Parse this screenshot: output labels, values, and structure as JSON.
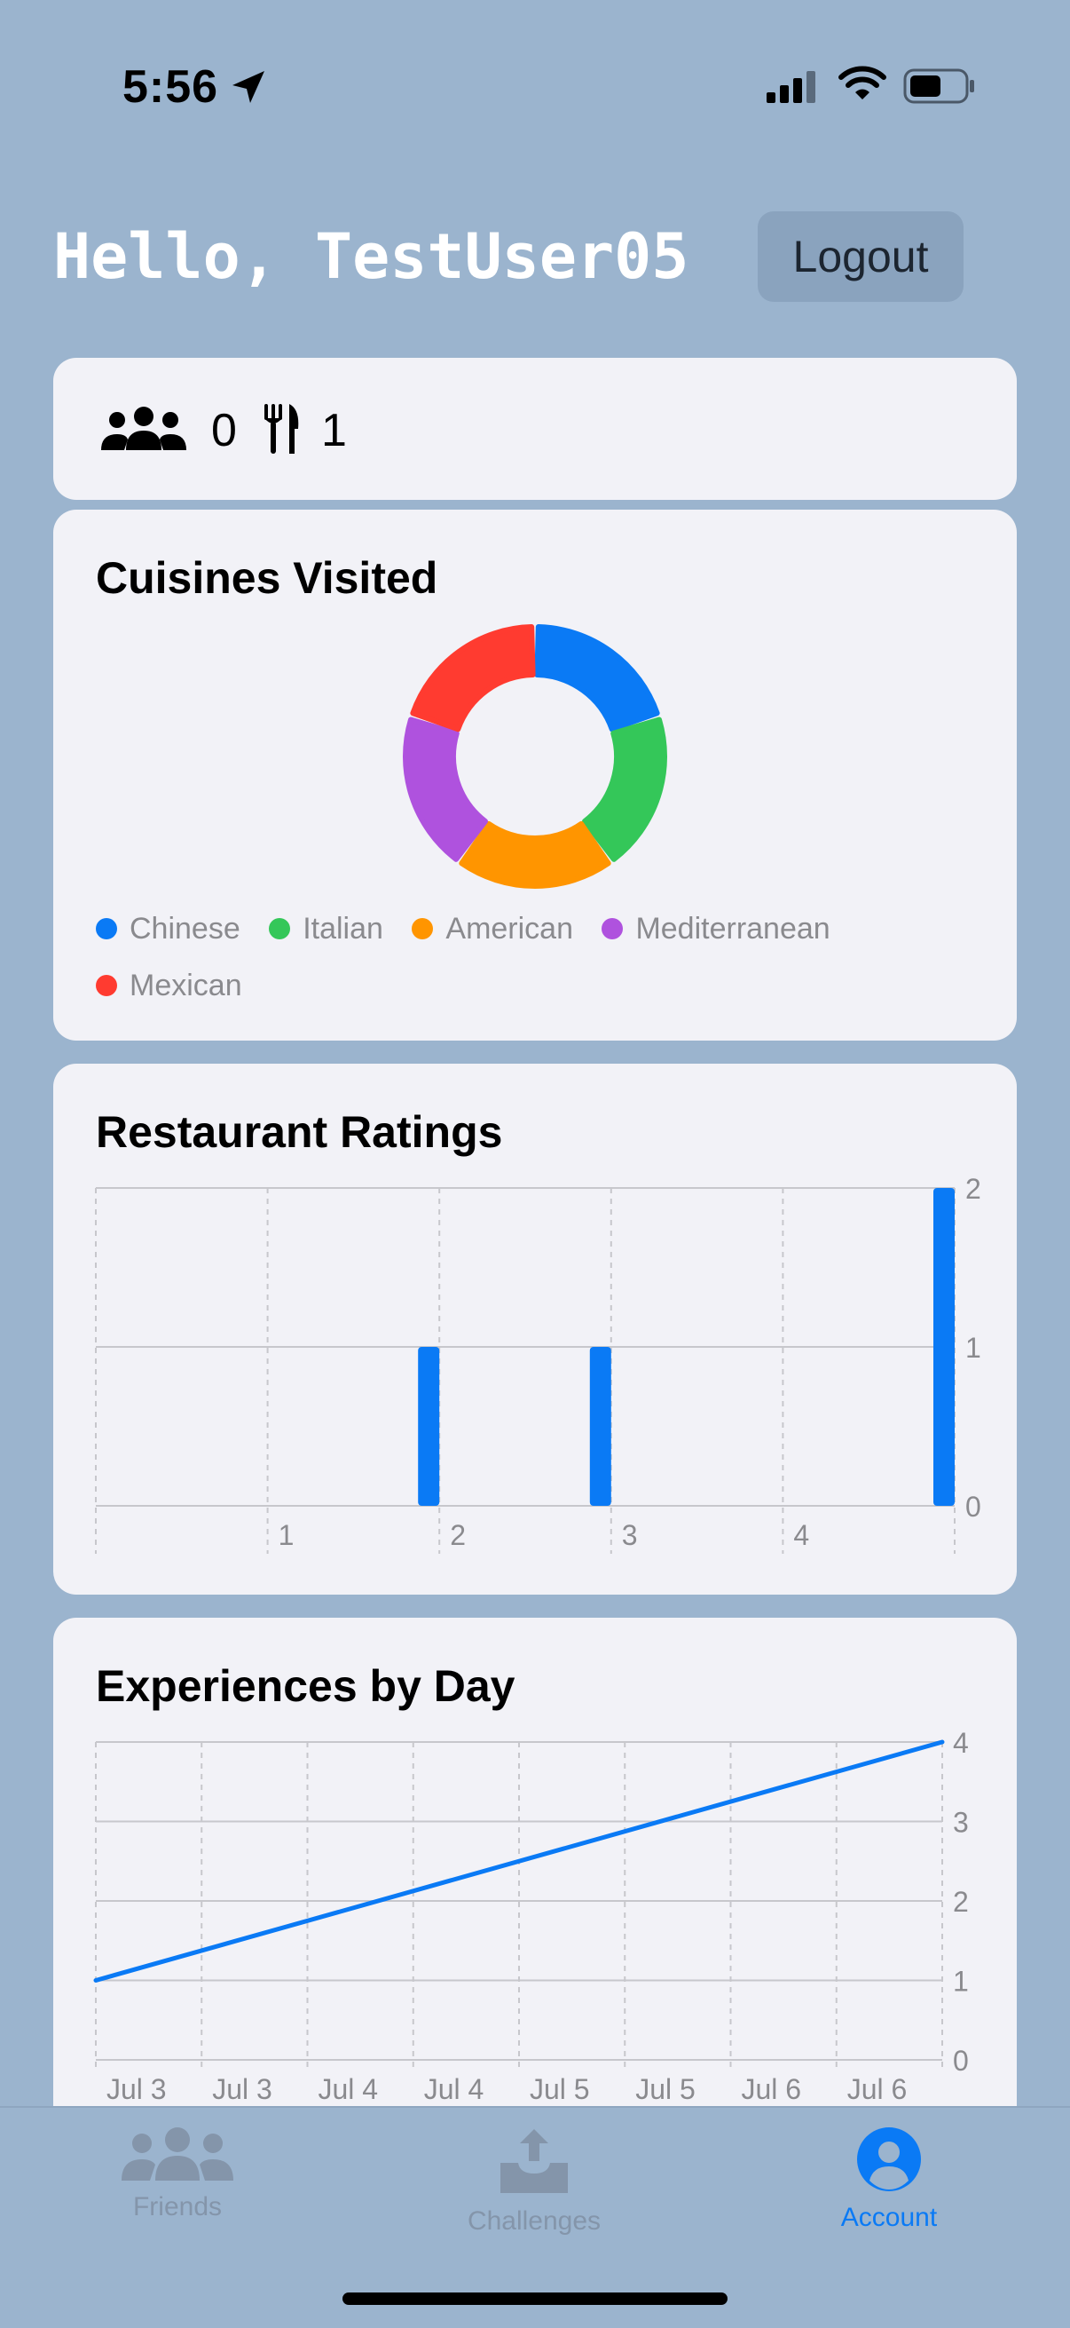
{
  "status_bar": {
    "time": "5:56"
  },
  "header": {
    "greeting": "Hello, TestUser05",
    "logout_label": "Logout"
  },
  "stats": {
    "friends_count": "0",
    "restaurants_count": "1"
  },
  "cuisines": {
    "title": "Cuisines Visited",
    "legend": [
      {
        "label": "Chinese",
        "color": "#0a7af5"
      },
      {
        "label": "Italian",
        "color": "#34c759"
      },
      {
        "label": "American",
        "color": "#ff9500"
      },
      {
        "label": "Mediterranean",
        "color": "#af52de"
      },
      {
        "label": "Mexican",
        "color": "#ff3b30"
      }
    ]
  },
  "ratings": {
    "title": "Restaurant Ratings"
  },
  "experiences": {
    "title": "Experiences by Day"
  },
  "chart_data": [
    {
      "type": "pie",
      "title": "Cuisines Visited",
      "categories": [
        "Chinese",
        "Italian",
        "American",
        "Mediterranean",
        "Mexican"
      ],
      "values": [
        1,
        1,
        1,
        1,
        1
      ],
      "colors": [
        "#0a7af5",
        "#34c759",
        "#ff9500",
        "#af52de",
        "#ff3b30"
      ],
      "style": "donut",
      "legend": "bottom"
    },
    {
      "type": "bar",
      "title": "Restaurant Ratings",
      "categories": [
        "1",
        "2",
        "3",
        "4",
        "5"
      ],
      "x_tick_labels": [
        "1",
        "2",
        "3",
        "4",
        ""
      ],
      "values": [
        0,
        1,
        1,
        0,
        2
      ],
      "y_ticks": [
        "0",
        "1",
        "2"
      ],
      "ylim": [
        0,
        2
      ],
      "color": "#0a7af5",
      "grid": true
    },
    {
      "type": "line",
      "title": "Experiences by Day",
      "x": [
        "Jul 3",
        "Jul 3",
        "Jul 4",
        "Jul 4",
        "Jul 5",
        "Jul 5",
        "Jul 6",
        "Jul 6"
      ],
      "series": [
        {
          "points": [
            [
              0,
              1
            ],
            [
              8,
              4
            ]
          ]
        }
      ],
      "y_ticks": [
        "0",
        "1",
        "2",
        "3",
        "4"
      ],
      "ylim": [
        0,
        4
      ],
      "color": "#0a7af5",
      "grid": true
    }
  ],
  "tabs": [
    {
      "label": "Friends",
      "icon": "people-icon",
      "active": false
    },
    {
      "label": "Challenges",
      "icon": "tray-upload-icon",
      "active": false
    },
    {
      "label": "Account",
      "icon": "person-circle-icon",
      "active": true
    }
  ]
}
